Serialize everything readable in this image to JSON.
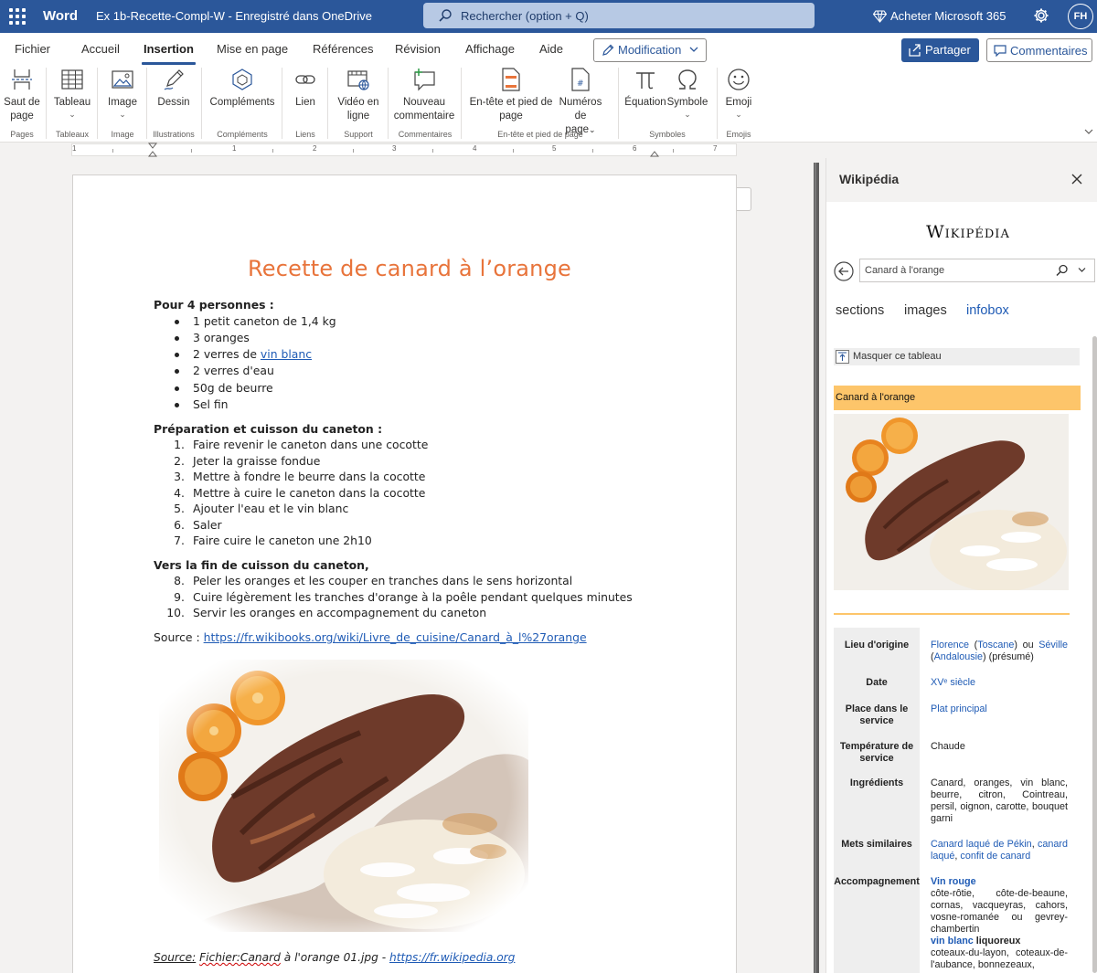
{
  "titlebar": {
    "app_name": "Word",
    "doc_title": "Ex 1b-Recette-Compl-W  -  Enregistré dans OneDrive",
    "search_placeholder": "Rechercher (option + Q)",
    "buy_label": "Acheter Microsoft 365",
    "avatar_initials": "FH",
    "color": "#2b579a"
  },
  "ribbon": {
    "tabs": [
      "Fichier",
      "Accueil",
      "Insertion",
      "Mise en page",
      "Références",
      "Révision",
      "Affichage",
      "Aide"
    ],
    "active_tab": "Insertion",
    "mode_label": "Modification",
    "share_label": "Partager",
    "comments_label": "Commentaires",
    "tools": {
      "page_break": [
        "Saut de",
        "page"
      ],
      "table": "Tableau",
      "image": "Image",
      "drawing": "Dessin",
      "addins": "Compléments",
      "link": "Lien",
      "video": [
        "Vidéo en",
        "ligne"
      ],
      "comment": [
        "Nouveau",
        "commentaire"
      ],
      "header_footer": [
        "En-tête et pied de",
        "page"
      ],
      "page_numbers": [
        "Numéros de",
        "page"
      ],
      "equation": "Équation",
      "symbol": "Symbole",
      "emoji": "Emoji"
    },
    "groups": {
      "pages": "Pages",
      "tables": "Tableaux",
      "image": "Image",
      "illustrations": "Illustrations",
      "addins": "Compléments",
      "links": "Liens",
      "media": "Support",
      "comments": "Commentaires",
      "header_footer": "En-tête et pied de page",
      "symbols": "Symboles",
      "emojis": "Emojis"
    }
  },
  "ruler": [
    "1",
    "1",
    "2",
    "3",
    "4",
    "5",
    "6",
    "7"
  ],
  "document": {
    "title": "Recette de canard à l’orange",
    "servings_heading": "Pour 4 personnes :",
    "ingredients": [
      "1 petit caneton de 1,4 kg",
      "3 oranges",
      "2 verres de ",
      "2 verres d'eau",
      "50g de beurre",
      "Sel fin"
    ],
    "ingredient_link": "vin blanc",
    "prep_heading": "Préparation et cuisson du caneton :",
    "prep_steps": [
      {
        "n": "1.",
        "t": "Faire revenir le caneton dans une cocotte"
      },
      {
        "n": "2.",
        "t": "Jeter la graisse fondue"
      },
      {
        "n": "3.",
        "t": "Mettre à fondre le beurre dans la cocotte"
      },
      {
        "n": "4.",
        "t": "Mettre à cuire le caneton dans la cocotte"
      },
      {
        "n": "5.",
        "t": "Ajouter l'eau et le vin blanc"
      },
      {
        "n": "6.",
        "t": "Saler"
      },
      {
        "n": "7.",
        "t": "Faire cuire le caneton une 2h10"
      }
    ],
    "end_heading": "Vers la fin de cuisson du caneton,",
    "end_steps": [
      {
        "n": "8.",
        "t": "Peler les oranges et les couper en tranches dans le sens horizontal"
      },
      {
        "n": "9.",
        "t": "Cuire légèrement les tranches d'orange à la poêle pendant quelques minutes"
      },
      {
        "n": "10.",
        "t": "Servir les oranges en accompagnement du caneton"
      }
    ],
    "source_label": "Source : ",
    "source_url": "https://fr.wikibooks.org/wiki/Livre_de_cuisine/Canard_à_l%27orange",
    "caption_source": "Source:",
    "caption_file": "Fichier:Canard",
    "caption_rest": " à l'orange 01.jpg - ",
    "caption_url": "https://fr.wikipedia.org",
    "title_color": "#e8743b"
  },
  "pane": {
    "title": "Wikipédia",
    "logo": "Wikipédia",
    "search_value": "Canard à l'orange",
    "tabs": [
      "sections",
      "images",
      "infobox"
    ],
    "active_tab": "infobox",
    "hide_table": "Masquer ce tableau",
    "infobox_title": "Canard à l'orange",
    "infobox_color": "#fdc56a",
    "rows": {
      "origin_label": "Lieu d'origine",
      "origin_a1": "Florence",
      "origin_p1": " (",
      "origin_a2": "Toscane",
      "origin_p2": ") ou ",
      "origin_a3": "Séville",
      "origin_p3": " (",
      "origin_a4": "Andalousie",
      "origin_p4": ") (présumé)",
      "date_label": "Date",
      "date_value": "XVᵉ siècle",
      "service_label": "Place dans le service",
      "service_value": "Plat principal",
      "temp_label": "Température de service",
      "temp_value": "Chaude",
      "ingredients_label": "Ingrédients",
      "ingredients_value": "Canard, oranges, vin blanc, beurre, citron, Cointreau, persil, oignon, carotte, bouquet garni",
      "similar_label": "Mets similaires",
      "similar_a1": "Canard laqué de Pékin",
      "similar_p1": ", ",
      "similar_a2": "canard laqué",
      "similar_p2": ", ",
      "similar_a3": "confit de canard",
      "accomp_label": "Accompagnement",
      "accomp_red": "Vin rouge",
      "accomp_red_list": "côte-rôtie, côte-de-beaune, cornas, vacqueyras, cahors, vosne-romanée ou gevrey-chambertin",
      "accomp_white_a": "vin blanc",
      "accomp_white_b": " liquoreux",
      "accomp_white_list": "coteaux-du-layon, coteaux-de-l'aubance, bonnezeaux,"
    }
  }
}
